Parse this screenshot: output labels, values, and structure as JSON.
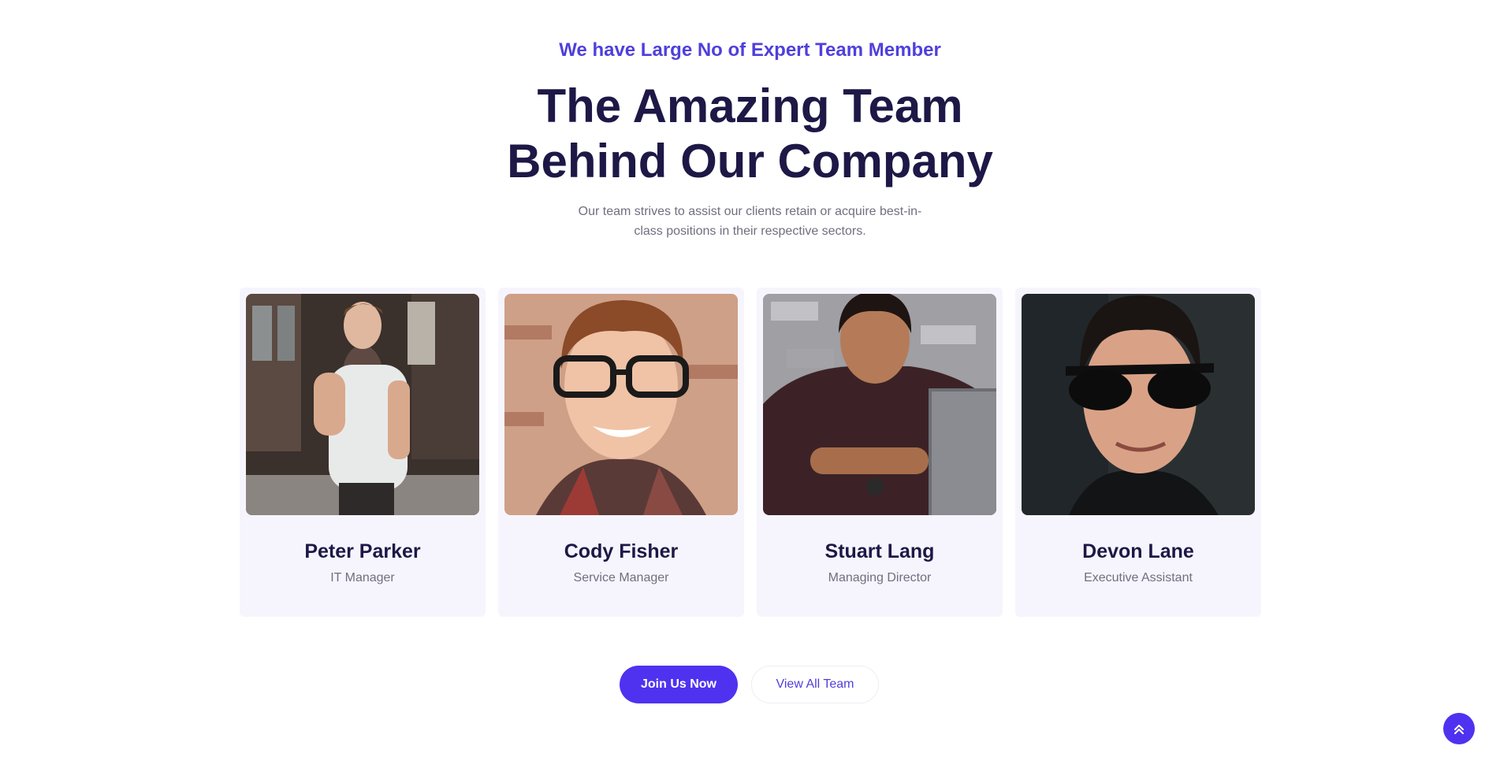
{
  "header": {
    "subtitle": "We have Large No of Expert Team Member",
    "title": "The Amazing Team Behind Our Company",
    "description": "Our team strives to assist our clients retain or acquire best-in-class positions in their respective sectors."
  },
  "team": [
    {
      "name": "Peter Parker",
      "role": "IT Manager"
    },
    {
      "name": "Cody Fisher",
      "role": "Service Manager"
    },
    {
      "name": "Stuart Lang",
      "role": "Managing Director"
    },
    {
      "name": "Devon Lane",
      "role": "Executive Assistant"
    }
  ],
  "actions": {
    "join_label": "Join Us Now",
    "view_label": "View All Team"
  },
  "colors": {
    "accent": "#4f32f0",
    "heading": "#1d1846",
    "card_bg": "#f6f5fd"
  },
  "icons": {
    "scroll_top": "chevron-double-up-icon"
  }
}
